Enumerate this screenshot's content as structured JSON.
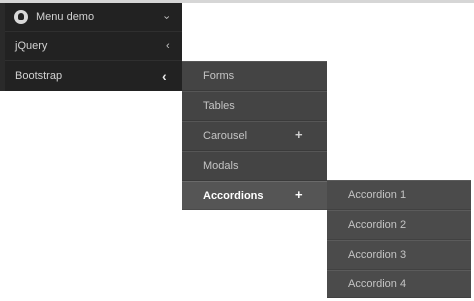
{
  "level1": {
    "items": [
      {
        "label": "Menu demo",
        "icon": "github-icon",
        "chevron": "chevron-down-icon"
      },
      {
        "label": "jQuery",
        "chevron": "chevron-left-icon"
      },
      {
        "label": "Bootstrap",
        "chevron": "chevron-left-icon"
      }
    ]
  },
  "level2": {
    "items": [
      {
        "label": "Forms"
      },
      {
        "label": "Tables"
      },
      {
        "label": "Carousel",
        "expand_icon": "+"
      },
      {
        "label": "Modals"
      },
      {
        "label": "Accordions",
        "expand_icon": "+"
      }
    ]
  },
  "level3": {
    "items": [
      {
        "label": "Accordion 1"
      },
      {
        "label": "Accordion 2"
      },
      {
        "label": "Accordion 3"
      },
      {
        "label": "Accordion 4"
      }
    ]
  },
  "colors": {
    "level1_bg": "#222222",
    "level2_bg": "#444444",
    "level3_bg": "#4b4b4b",
    "active_bg": "#555555",
    "text": "#c4c4c4"
  },
  "icons": {
    "chevron_down": "›",
    "chevron_left": "‹"
  }
}
